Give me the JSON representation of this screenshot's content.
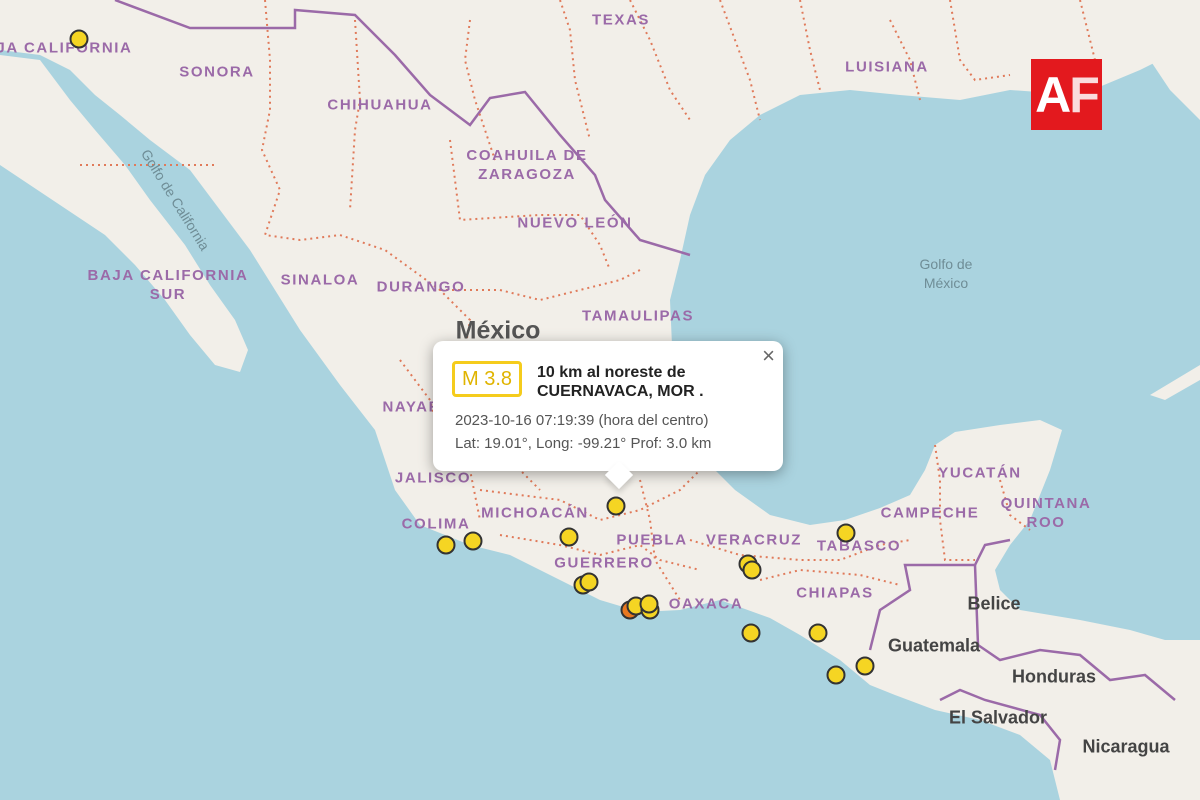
{
  "map": {
    "water_labels": [
      {
        "text": "Golfo de\nMéxico"
      }
    ],
    "gulf_california_label": "Golfo de California",
    "states": [
      "BAJA CALIFORNIA",
      "SONORA",
      "CHIHUAHUA",
      "COAHUILA DE ZARAGOZA",
      "NUEVO LEÓN",
      "BAJA CALIFORNIA SUR",
      "SINALOA",
      "DURANGO",
      "TAMAULIPAS",
      "NAYARIT",
      "JALISCO",
      "COLIMA",
      "MICHOACÁN",
      "GUERRERO",
      "PUEBLA",
      "VERACRUZ",
      "TABASCO",
      "OAXACA",
      "CHIAPAS",
      "YUCATÁN",
      "CAMPECHE",
      "QUINTANA ROO",
      "TEXAS",
      "LUISIANA"
    ],
    "countries": [
      "México",
      "Belice",
      "Guatemala",
      "Honduras",
      "El Salvador",
      "Nicaragua"
    ],
    "colors": {
      "water": "#aad3df",
      "land": "#f2efe9",
      "state_border": "#e07a5a",
      "country_border": "#9b6aa8",
      "quake": "#f5d523",
      "quake_strong": "#e8781f"
    }
  },
  "logo": {
    "a": "A",
    "f": "F"
  },
  "popup": {
    "magnitude": "M 3.8",
    "place_line1": "10 km al noreste de",
    "place_line2": "CUERNAVACA, MOR .",
    "datetime": "2023-10-16   07:19:39 (hora del centro)",
    "coords": "Lat: 19.01°, Long: -99.21°  Prof: 3.0 km",
    "close_icon": "×"
  }
}
